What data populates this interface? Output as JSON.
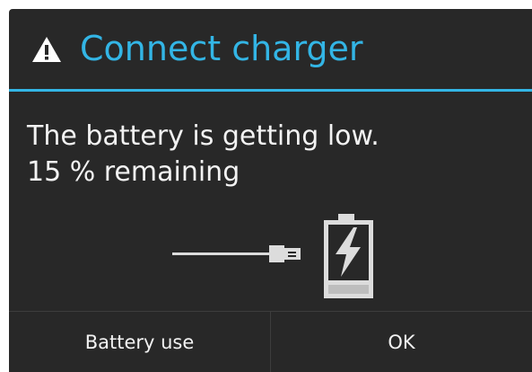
{
  "dialog": {
    "title": "Connect charger",
    "title_icon": "warning-icon",
    "message_line1": "The battery is getting low.",
    "message_line2": "15 % remaining",
    "illustration": {
      "cable_icon": "usb-cable-icon",
      "battery_icon": "battery-charging-icon"
    },
    "buttons": {
      "battery_use": "Battery use",
      "ok": "OK"
    },
    "accent_color": "#33b5e5",
    "background_color": "#282828",
    "text_color": "#f2f2f2"
  }
}
